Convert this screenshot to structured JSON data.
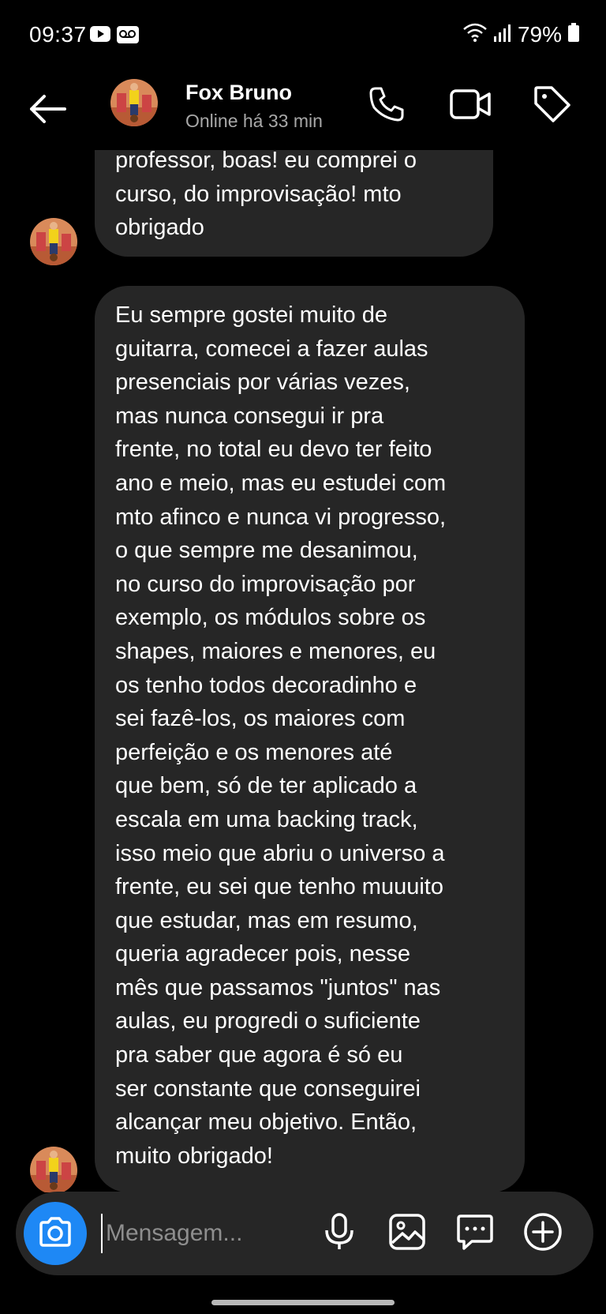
{
  "status_bar": {
    "time": "09:37",
    "battery": "79%",
    "icons": [
      "youtube-icon",
      "voicemail-icon",
      "wifi-icon",
      "signal-icon",
      "battery-icon"
    ]
  },
  "header": {
    "contact_name": "Fox Bruno",
    "contact_status": "Online há 33 min",
    "icons": [
      "back-arrow-icon",
      "phone-icon",
      "video-camera-icon",
      "tag-icon"
    ]
  },
  "messages": [
    {
      "lines": [
        "professor, boas! eu comprei o",
        "curso, do improvisação! mto",
        "obrigado"
      ]
    },
    {
      "lines": [
        "Eu sempre gostei muito de",
        "guitarra, comecei a fazer aulas",
        "presenciais por várias vezes,",
        "mas nunca consegui ir pra",
        "frente, no total eu devo ter feito",
        "ano e meio, mas eu estudei com",
        "mto afinco e nunca vi progresso,",
        "o que sempre me desanimou,",
        "no curso do improvisação por",
        "exemplo, os módulos sobre os",
        "shapes, maiores e menores, eu",
        "os tenho todos decoradinho e",
        "sei fazê-los, os maiores com",
        "perfeição e os menores até",
        "que bem, só de ter aplicado a",
        "escala em uma backing track,",
        "isso meio que abriu o universo a",
        "frente, eu sei que tenho muuuito",
        "que estudar, mas em resumo,",
        "queria agradecer pois, nesse",
        "mês que passamos \"juntos\" nas",
        "aulas, eu progredi o suficiente",
        "pra saber que agora é só eu",
        "ser constante que conseguirei",
        "alcançar meu objetivo. Então,",
        "muito obrigado!"
      ]
    }
  ],
  "composer": {
    "placeholder": "Mensagem...",
    "icons": [
      "camera-icon",
      "microphone-icon",
      "gallery-icon",
      "sticker-icon",
      "plus-circle-icon"
    ]
  },
  "colors": {
    "background": "#000000",
    "bubble": "#262626",
    "accent": "#1e88f5",
    "muted_text": "#a8a8a8"
  }
}
